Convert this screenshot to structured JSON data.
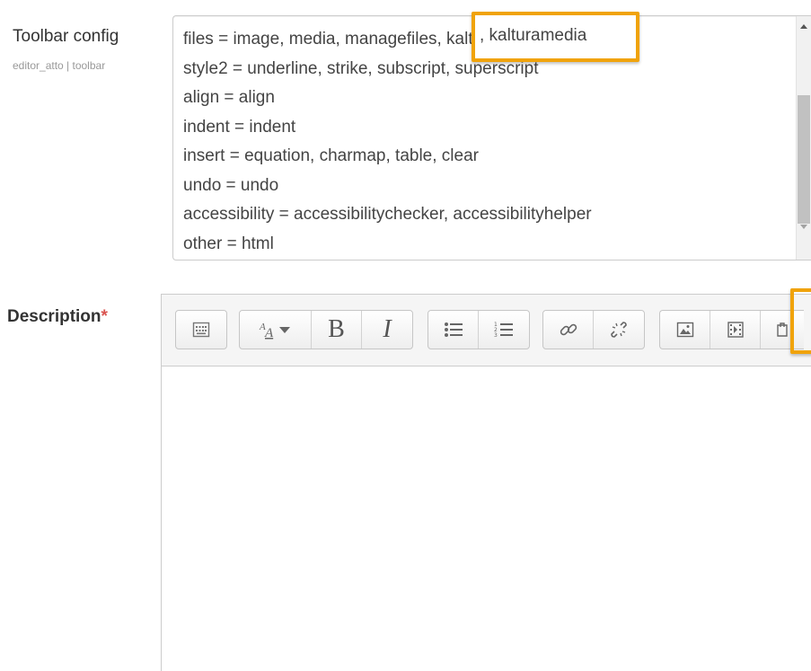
{
  "toolbar_setting": {
    "label": "Toolbar config",
    "sublabel": "editor_atto | toolbar",
    "lines": [
      "files = image, media, managefiles, kalturamedia",
      "style2 = underline, strike, subscript, superscript",
      "align = align",
      "indent = indent",
      "insert = equation, charmap, table, clear",
      "undo = undo",
      "accessibility = accessibilitychecker, accessibilityhelper",
      "other = html"
    ],
    "highlight_text": ", kalturamedia",
    "highlight_color": "#f0a30a"
  },
  "description": {
    "label": "Description",
    "required_mark": "*",
    "required_color": "#d9534f",
    "toolbar_icons": [
      "collapse-toolbar-icon",
      "paragraph-styles-icon",
      "bold-icon",
      "italic-icon",
      "unordered-list-icon",
      "ordered-list-icon",
      "link-icon",
      "unlink-icon",
      "insert-image-icon",
      "insert-media-icon",
      "manage-files-icon"
    ],
    "bold_glyph": "B",
    "italic_glyph": "I"
  }
}
